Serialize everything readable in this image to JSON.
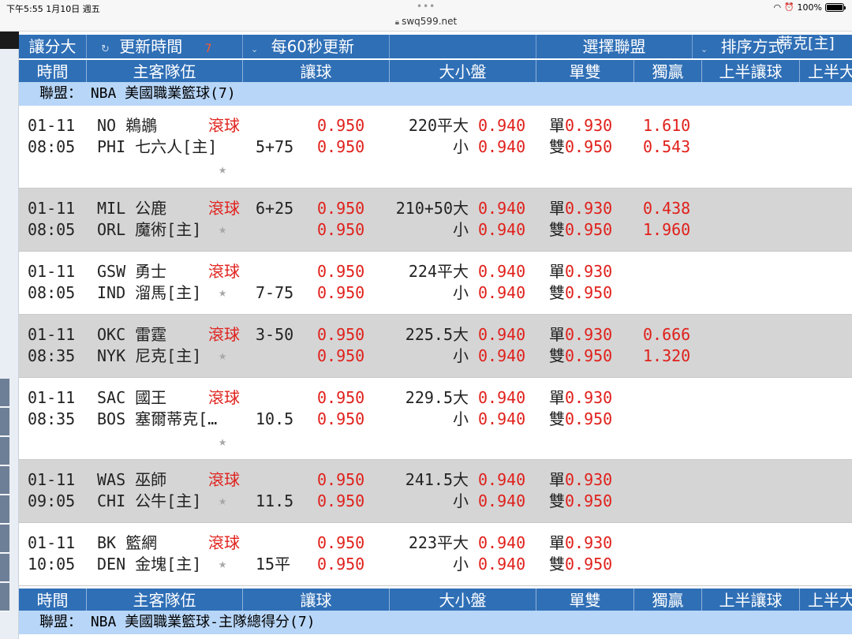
{
  "status_bar": {
    "time_date": "下午5:55  1月10日 週五",
    "url": "swq599.net",
    "battery": "100%",
    "battery_level": 1.0
  },
  "toolbar": {
    "handicap_big": "讓分大",
    "refresh_icon": "↻",
    "update_time": "更新時間",
    "countdown": "7",
    "caret": "⌄",
    "auto_refresh": "每60秒更新",
    "select_league": "選擇聯盟",
    "sort": "排序方式",
    "overflow_text": "蒂克[主]"
  },
  "headers": {
    "time": "時間",
    "teams": "主客隊伍",
    "handicap": "讓球",
    "over_under": "大小盤",
    "odd_even": "單雙",
    "moneyline": "獨贏",
    "first_half_handicap": "上半讓球",
    "first_half_cut": "上半大"
  },
  "leagues": [
    {
      "label": "聯盟： NBA 美國職業籃球(7)"
    },
    {
      "label": "聯盟： NBA 美國職業籃球-主隊總得分(7)"
    }
  ],
  "games": [
    {
      "date": "01-11",
      "time": "08:05",
      "away": "NO 鵜鶘",
      "home": "PHI 七六人[主]",
      "live": "滾球",
      "hcp_top": "",
      "hcp_bottom": "5+75",
      "hodds_top": "0.950",
      "hodds_bottom": "0.950",
      "ou_top": "220平大",
      "ou_bottom": "小",
      "ouodds_top": "0.940",
      "ouodds_bottom": "0.940",
      "odd_label": "單",
      "odd_val": "0.930",
      "even_label": "雙",
      "even_val": "0.950",
      "ml_top": "1.610",
      "ml_bottom": "0.543",
      "star": "★"
    },
    {
      "date": "01-11",
      "time": "08:05",
      "away": "MIL 公鹿",
      "home": "ORL 魔術[主]",
      "live": "滾球",
      "hcp_top": "6+25",
      "hcp_bottom": "",
      "hodds_top": "0.950",
      "hodds_bottom": "0.950",
      "ou_top": "210+50大",
      "ou_bottom": "小",
      "ouodds_top": "0.940",
      "ouodds_bottom": "0.940",
      "odd_label": "單",
      "odd_val": "0.930",
      "even_label": "雙",
      "even_val": "0.950",
      "ml_top": "0.438",
      "ml_bottom": "1.960",
      "star": "★"
    },
    {
      "date": "01-11",
      "time": "08:05",
      "away": "GSW 勇士",
      "home": "IND 溜馬[主]",
      "live": "滾球",
      "hcp_top": "",
      "hcp_bottom": "7-75",
      "hodds_top": "0.950",
      "hodds_bottom": "0.950",
      "ou_top": "224平大",
      "ou_bottom": "小",
      "ouodds_top": "0.940",
      "ouodds_bottom": "0.940",
      "odd_label": "單",
      "odd_val": "0.930",
      "even_label": "雙",
      "even_val": "0.950",
      "ml_top": "",
      "ml_bottom": "",
      "star": "★"
    },
    {
      "date": "01-11",
      "time": "08:35",
      "away": "OKC 雷霆",
      "home": "NYK 尼克[主]",
      "live": "滾球",
      "hcp_top": "3-50",
      "hcp_bottom": "",
      "hodds_top": "0.950",
      "hodds_bottom": "0.950",
      "ou_top": "225.5大",
      "ou_bottom": "小",
      "ouodds_top": "0.940",
      "ouodds_bottom": "0.940",
      "odd_label": "單",
      "odd_val": "0.930",
      "even_label": "雙",
      "even_val": "0.950",
      "ml_top": "0.666",
      "ml_bottom": "1.320",
      "star": "★"
    },
    {
      "date": "01-11",
      "time": "08:35",
      "away": "SAC 國王",
      "home": "BOS 塞爾蒂克[…",
      "live": "滾球",
      "hcp_top": "",
      "hcp_bottom": "10.5",
      "hodds_top": "0.950",
      "hodds_bottom": "0.950",
      "ou_top": "229.5大",
      "ou_bottom": "小",
      "ouodds_top": "0.940",
      "ouodds_bottom": "0.940",
      "odd_label": "單",
      "odd_val": "0.930",
      "even_label": "雙",
      "even_val": "0.950",
      "ml_top": "",
      "ml_bottom": "",
      "star": "★"
    },
    {
      "date": "01-11",
      "time": "09:05",
      "away": "WAS 巫師",
      "home": "CHI 公牛[主]",
      "live": "滾球",
      "hcp_top": "",
      "hcp_bottom": "11.5",
      "hodds_top": "0.950",
      "hodds_bottom": "0.950",
      "ou_top": "241.5大",
      "ou_bottom": "小",
      "ouodds_top": "0.940",
      "ouodds_bottom": "0.940",
      "odd_label": "單",
      "odd_val": "0.930",
      "even_label": "雙",
      "even_val": "0.950",
      "ml_top": "",
      "ml_bottom": "",
      "star": "★"
    },
    {
      "date": "01-11",
      "time": "10:05",
      "away": "BK 籃網",
      "home": "DEN 金塊[主]",
      "live": "滾球",
      "hcp_top": "",
      "hcp_bottom": "15平",
      "hodds_top": "0.950",
      "hodds_bottom": "0.950",
      "ou_top": "223平大",
      "ou_bottom": "小",
      "ouodds_top": "0.940",
      "ouodds_bottom": "0.940",
      "odd_label": "單",
      "odd_val": "0.930",
      "even_label": "雙",
      "even_val": "0.950",
      "ml_top": "",
      "ml_bottom": "",
      "star": "★"
    }
  ],
  "colors": {
    "header_blue": "#2f6fb6",
    "league_bar": "#b8d6f7",
    "odds_red": "#e0201b",
    "row_gray": "#d5d5d5"
  }
}
